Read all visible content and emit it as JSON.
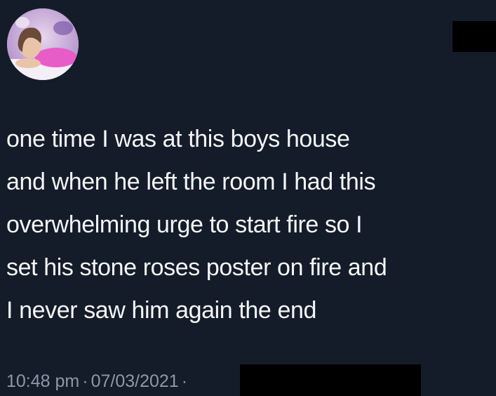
{
  "tweet": {
    "avatar_icon": "user-photo-avatar",
    "text_lines": [
      "one time I was at this boys house",
      "and when he left the room I had this",
      "overwhelming urge to start fire so I",
      "set his stone roses poster on fire and",
      "I never saw him again the end"
    ],
    "time": "10:48 pm",
    "separator": "·",
    "date": "07/03/2021",
    "trailing_separator": "·"
  },
  "colors": {
    "background": "#151c29",
    "text": "#f4f6f8",
    "meta_text": "#8c98a6",
    "redaction": "#000000"
  }
}
